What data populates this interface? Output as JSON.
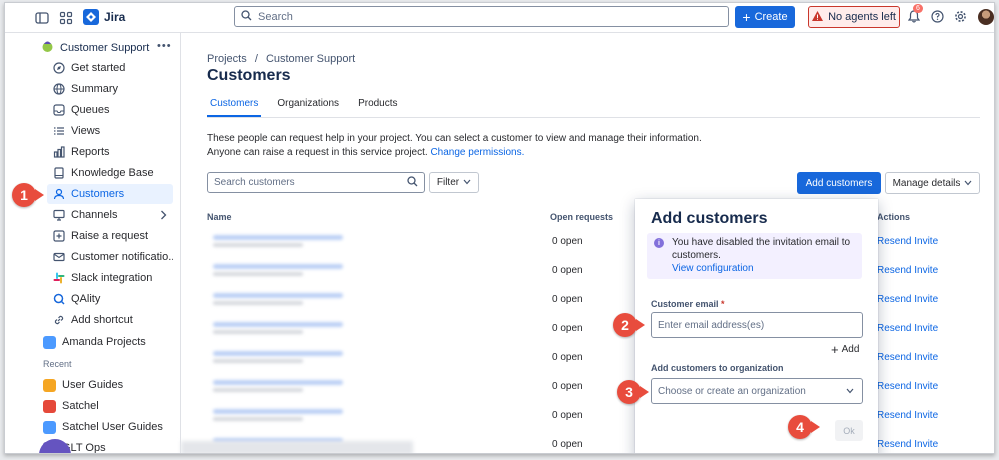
{
  "topnav": {
    "app_name": "Jira",
    "search_placeholder": "Search",
    "create_label": "Create",
    "agents_label": "No agents left",
    "notification_count": "6"
  },
  "sidebar": {
    "project_name": "Customer Support",
    "items": [
      {
        "label": "Get started",
        "icon": "rocket-icon"
      },
      {
        "label": "Summary",
        "icon": "globe-icon"
      },
      {
        "label": "Queues",
        "icon": "queue-icon"
      },
      {
        "label": "Views",
        "icon": "list-icon"
      },
      {
        "label": "Reports",
        "icon": "chart-icon"
      },
      {
        "label": "Knowledge Base",
        "icon": "book-icon"
      },
      {
        "label": "Customers",
        "icon": "person-icon",
        "active": true
      },
      {
        "label": "Channels",
        "icon": "monitor-icon"
      },
      {
        "label": "Raise a request",
        "icon": "plus-square-icon"
      },
      {
        "label": "Customer notificatio...",
        "icon": "mail-icon"
      },
      {
        "label": "Slack integration",
        "icon": "slack-icon"
      },
      {
        "label": "QAlity",
        "icon": "qality-icon"
      },
      {
        "label": "Add shortcut",
        "icon": "link-icon"
      }
    ],
    "other_project": "Amanda Projects",
    "recent_label": "Recent",
    "recent": [
      {
        "label": "User Guides",
        "color": "#f5a623"
      },
      {
        "label": "Satchel",
        "color": "#e5493a"
      },
      {
        "label": "Satchel User Guides",
        "color": "#4c9aff"
      },
      {
        "label": "GLT Ops",
        "color": "#6554c0"
      }
    ]
  },
  "main": {
    "breadcrumb_projects": "Projects",
    "breadcrumb_separator": "/",
    "breadcrumb_project": "Customer Support",
    "title": "Customers",
    "tabs": [
      "Customers",
      "Organizations",
      "Products"
    ],
    "description_line1": "These people can request help in your project. You can select a customer to view and manage their information.",
    "description_line2": "Anyone can raise a request in this service project.",
    "change_permissions": "Change permissions.",
    "search_placeholder": "Search customers",
    "filter_label": "Filter",
    "add_customers_label": "Add customers",
    "manage_details_label": "Manage details",
    "columns": {
      "name": "Name",
      "open_requests": "Open requests",
      "actions": "Actions"
    },
    "rows": [
      {
        "open": "0 open",
        "action": "Resend Invite"
      },
      {
        "open": "0 open",
        "action": "Resend Invite"
      },
      {
        "open": "0 open",
        "action": "Resend Invite"
      },
      {
        "open": "0 open",
        "action": "Resend Invite"
      },
      {
        "open": "0 open",
        "action": "Resend Invite"
      },
      {
        "open": "0 open",
        "action": "Resend Invite"
      },
      {
        "open": "0 open",
        "action": "Resend Invite"
      },
      {
        "open": "0 open",
        "action": "Resend Invite"
      }
    ]
  },
  "modal": {
    "title": "Add customers",
    "info_text": "You have disabled the invitation email to customers.",
    "info_link": "View configuration",
    "email_label": "Customer email",
    "required_mark": "*",
    "email_placeholder": "Enter email address(es)",
    "add_label": "Add",
    "org_label": "Add customers to organization",
    "org_placeholder": "Choose or create an organization",
    "ok_label": "Ok"
  },
  "callouts": [
    "1",
    "2",
    "3",
    "4"
  ]
}
